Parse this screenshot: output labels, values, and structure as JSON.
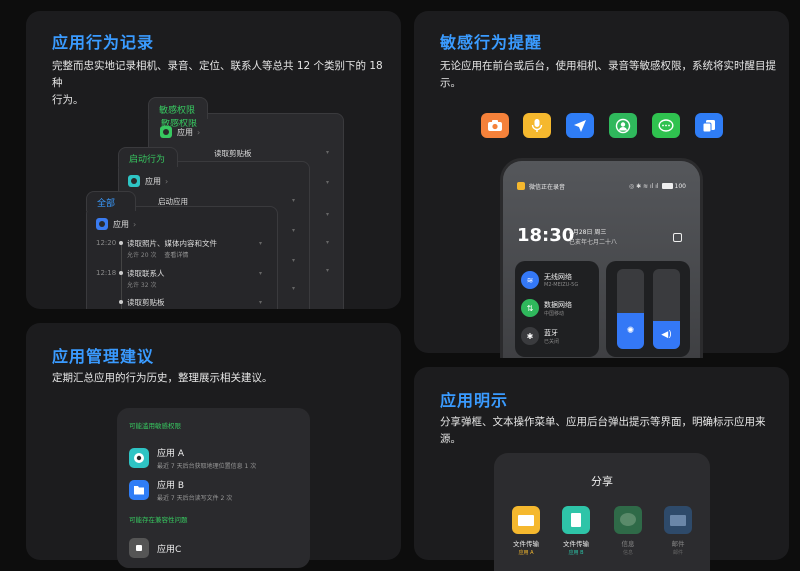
{
  "cards": {
    "records": {
      "title": "应用行为记录",
      "desc_line1": "完整而忠实地记录相机、录音、定位、联系人等总共 12 个类别下的 18 种",
      "desc_line2": "行为。",
      "layers": {
        "sensitive": {
          "label": "敏感权限",
          "app": "应用",
          "event": "读取剪贴板"
        },
        "startup": {
          "label": "启动行为",
          "app": "应用",
          "event": "启动应用"
        },
        "all": {
          "label": "全部",
          "app": "应用",
          "events": [
            {
              "time": "12:20",
              "name": "读取照片、媒体内容和文件",
              "sub": "允许 20 次",
              "link": "查看详情"
            },
            {
              "time": "12:18",
              "name": "读取联系人",
              "sub": "允许 32 次"
            },
            {
              "time": "",
              "name": "读取剪贴板",
              "sub": ""
            }
          ]
        }
      }
    },
    "alerts": {
      "title": "敏感行为提醒",
      "desc_line1": "无论应用在前台或后台，使用相机、录音等敏感权限，系统将实时醒目提",
      "desc_line2": "示。",
      "icons": [
        {
          "name": "camera-icon",
          "color": "#f5813a"
        },
        {
          "name": "microphone-icon",
          "color": "#f5b82e"
        },
        {
          "name": "location-icon",
          "color": "#2f7df6"
        },
        {
          "name": "contacts-icon",
          "color": "#2fb85c"
        },
        {
          "name": "message-icon",
          "color": "#2fc24f"
        },
        {
          "name": "clipboard-icon",
          "color": "#2f7df6"
        }
      ],
      "phone": {
        "status_text": "微信正在录音",
        "battery": "100",
        "time": "18:30",
        "date": "8月28日  周三",
        "lunar": "己亥年七月二十八",
        "wifi_name": "无线网络",
        "wifi_sub": "M2-MEIZU-5G",
        "data_name": "数据网络",
        "data_sub": "中国移动",
        "bt_name": "蓝牙",
        "bt_sub": "已关闭"
      }
    },
    "management": {
      "title": "应用管理建议",
      "desc": "定期汇总应用的行为历史，整理展示相关建议。",
      "sec1": "可能滥用敏感权限",
      "items": [
        {
          "name": "应用 A",
          "sub": "最近 7 天后台获取地理位置信息 1 次"
        },
        {
          "name": "应用 B",
          "sub": "最近 7 天后台读写文件 2 次"
        }
      ],
      "sec2": "可能存在兼容性问题",
      "item3": "应用C"
    },
    "explicit": {
      "title": "应用明示",
      "desc": "分享弹框、文本操作菜单、应用后台弹出提示等界面，明确标示应用来源。",
      "share_title": "分享",
      "share_items": [
        {
          "name": "文件传输",
          "sub": "应用 A"
        },
        {
          "name": "文件传输",
          "sub": "应用 B"
        },
        {
          "name": "信息",
          "sub": "信息"
        },
        {
          "name": "邮件",
          "sub": "邮件"
        }
      ]
    }
  }
}
